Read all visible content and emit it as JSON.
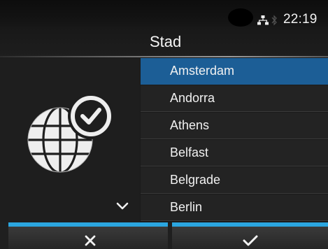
{
  "status_bar": {
    "clock": "22:19",
    "icons": [
      "network-icon",
      "bluetooth-icon"
    ]
  },
  "header": {
    "title": "Stad"
  },
  "left_panel": {
    "icon": "globe-clock-icon",
    "scroll_indicator": "chevron-down-icon"
  },
  "city_list": {
    "selected_index": 0,
    "items": [
      {
        "label": "Amsterdam"
      },
      {
        "label": "Andorra"
      },
      {
        "label": "Athens"
      },
      {
        "label": "Belfast"
      },
      {
        "label": "Belgrade"
      },
      {
        "label": "Berlin"
      }
    ]
  },
  "soft_keys": {
    "cancel_icon": "close-icon",
    "confirm_icon": "checkmark-icon"
  },
  "colors": {
    "selection": "#1c5e96",
    "soft_key_accent": "#2ba6e0",
    "background": "#1a1a1a"
  }
}
